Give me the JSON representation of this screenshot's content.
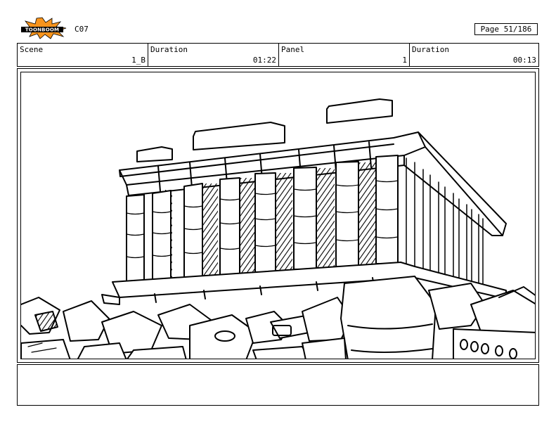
{
  "header": {
    "logo_text": "TOONBOOM",
    "production": "C07",
    "page_label": "Page",
    "page_value": "51/186"
  },
  "info": {
    "scene_label": "Scene",
    "scene_value": "1_B",
    "scene_duration_label": "Duration",
    "scene_duration_value": "01:22",
    "panel_label": "Panel",
    "panel_value": "1",
    "panel_duration_label": "Duration",
    "panel_duration_value": "00:13"
  },
  "panel": {
    "image": "pencil-sketch-greek-temple-on-rubble"
  },
  "notes": {
    "text": ""
  },
  "colors": {
    "logo_orange": "#f7941d",
    "ink": "#000000",
    "paper": "#ffffff"
  }
}
